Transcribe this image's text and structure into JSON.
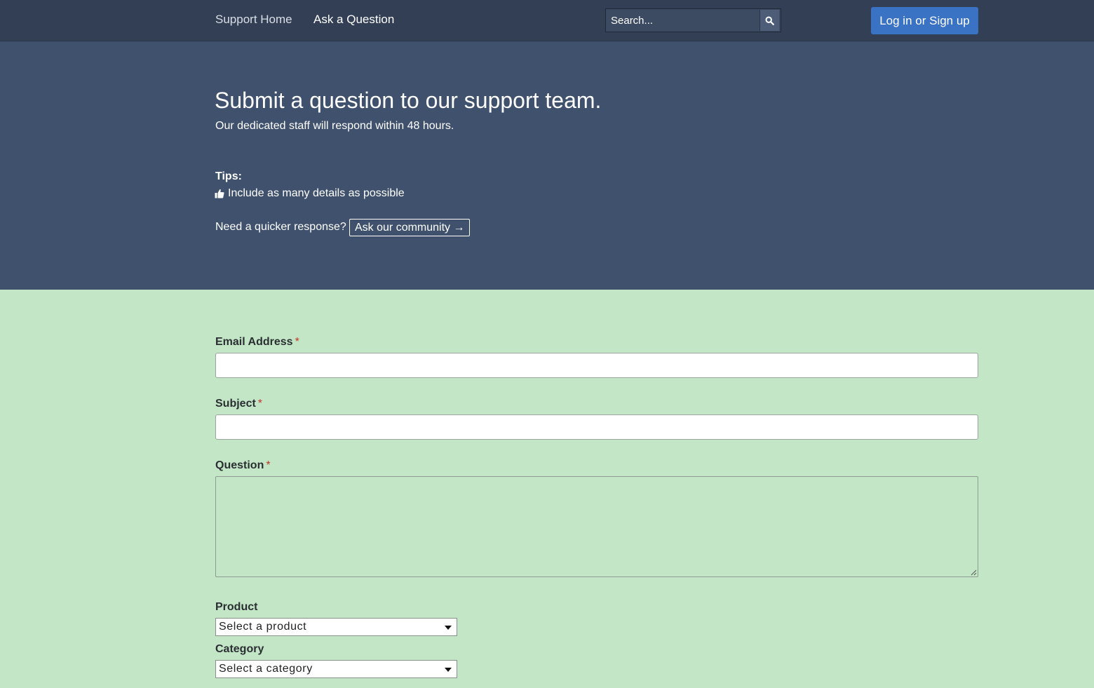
{
  "nav": {
    "support_home": "Support Home",
    "ask_question": "Ask a Question",
    "search_placeholder": "Search...",
    "login_label": "Log in or Sign up"
  },
  "hero": {
    "title": "Submit a question to our support team.",
    "subtitle": "Our dedicated staff will respond within 48 hours.",
    "tips_label": "Tips:",
    "tips": [
      "Include as many details as possible"
    ],
    "quicker_text": "Need a quicker response?",
    "community_label": "Ask our community →"
  },
  "form": {
    "email_label": "Email Address",
    "subject_label": "Subject",
    "question_label": "Question",
    "required_mark": "*",
    "product_label": "Product",
    "product_selected": "Select a product",
    "category_label": "Category",
    "category_selected": "Select a category"
  },
  "colors": {
    "topbar": "#323f55",
    "hero": "#3f516c",
    "form_bg": "#c2e6c6",
    "primary_button": "#3b73c4",
    "required": "#c0392b"
  },
  "icons": {
    "search": "search-icon",
    "tip": "thumbs-up-icon",
    "select_caret": "caret-down-icon"
  }
}
